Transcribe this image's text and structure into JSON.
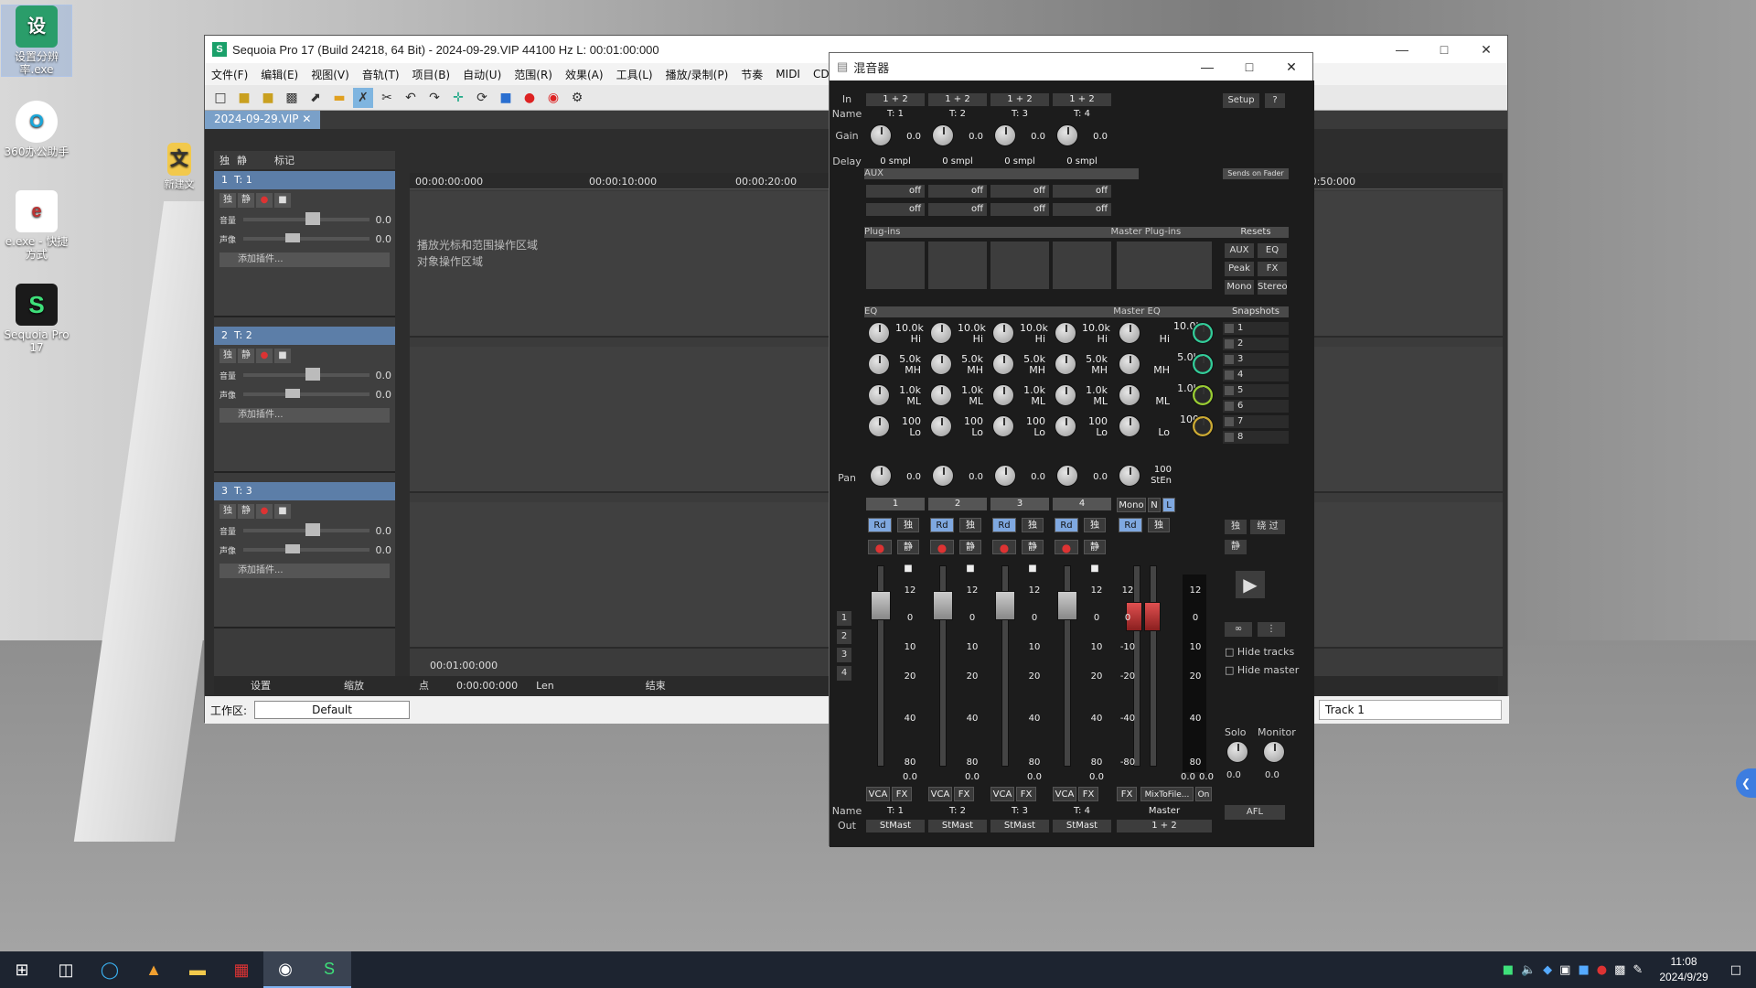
{
  "desktop": {
    "icons": [
      {
        "label": "设置分辨率.exe",
        "color": "#2a9d6a",
        "glyph": "设"
      },
      {
        "label": "360办公助手",
        "color": "#19a6d9",
        "glyph": "O"
      },
      {
        "label": "新建文",
        "color": "#f2c94c",
        "glyph": "文"
      },
      {
        "label": "e.exe - 快捷方式",
        "color": "#b33",
        "glyph": "e"
      },
      {
        "label": "Sequoia Pro 17",
        "color": "#1ca25f",
        "glyph": "S"
      }
    ]
  },
  "main_window": {
    "title": "Sequoia Pro 17 (Build 24218, 64 Bit) - 2024-09-29.VIP   44100 Hz L: 00:01:00:000",
    "menu": [
      "文件(F)",
      "编辑(E)",
      "视图(V)",
      "音轨(T)",
      "项目(B)",
      "自动(U)",
      "范围(R)",
      "效果(A)",
      "工具(L)",
      "播放/录制(P)",
      "节奏",
      "MIDI",
      "CD/D"
    ],
    "tab": "2024-09-29.VIP",
    "header_row": {
      "solo": "独",
      "mute": "静",
      "markers": "标记"
    },
    "tracks": [
      {
        "num": "1",
        "name": "T: 1"
      },
      {
        "num": "2",
        "name": "T: 2"
      },
      {
        "num": "3",
        "name": "T: 3"
      }
    ],
    "track_controls": {
      "solo": "独",
      "mute": "静",
      "volume": "音量",
      "pan": "声像",
      "plugin": "添加插件...",
      "vol_value": "0.0",
      "pan_value": "0.0"
    },
    "ruler": [
      "00:00:00:000",
      "00:00:10:000",
      "00:00:20:00",
      "00:00:50:000"
    ],
    "lane_hints": [
      "播放光标和范围操作区域",
      "对象操作区域"
    ],
    "bottom": {
      "settings": "设置",
      "zoom": "缩放",
      "position": "00:01:00:000",
      "point": "点",
      "point_time": "0:00:00:000",
      "len": "Len",
      "end": "结束"
    },
    "workspace_label": "工作区:",
    "workspace_value": "Default",
    "status_track": "Track 1"
  },
  "mixer": {
    "title": "混音器",
    "row_labels": {
      "in": "In",
      "name": "Name",
      "gain": "Gain",
      "delay": "Delay",
      "pan": "Pan",
      "out": "Out"
    },
    "section_titles": {
      "aux": "AUX",
      "plugins": "Plug-ins",
      "master_plugins": "Master Plug-ins",
      "eq": "EQ",
      "master_eq": "Master EQ",
      "resets": "Resets",
      "snapshots": "Snapshots",
      "sends_on_fader": "Sends on Fader"
    },
    "channels": [
      {
        "in": "1 + 2",
        "name": "T: 1",
        "gain": "0.0",
        "delay": "0 smpl",
        "aux1": "off",
        "aux2": "off",
        "pan": "0.0",
        "num": "1",
        "out": "StMast",
        "level": "0.0"
      },
      {
        "in": "1 + 2",
        "name": "T: 2",
        "gain": "0.0",
        "delay": "0 smpl",
        "aux1": "off",
        "aux2": "off",
        "pan": "0.0",
        "num": "2",
        "out": "StMast",
        "level": "0.0"
      },
      {
        "in": "1 + 2",
        "name": "T: 3",
        "gain": "0.0",
        "delay": "0 smpl",
        "aux1": "off",
        "aux2": "off",
        "pan": "0.0",
        "num": "3",
        "out": "StMast",
        "level": "0.0"
      },
      {
        "in": "1 + 2",
        "name": "T: 4",
        "gain": "0.0",
        "delay": "0 smpl",
        "aux1": "off",
        "aux2": "off",
        "pan": "0.0",
        "num": "4",
        "out": "StMast",
        "level": "0.0"
      }
    ],
    "eq_bands": [
      {
        "freq": "10.0k",
        "label": "Hi"
      },
      {
        "freq": "5.0k",
        "label": "MH"
      },
      {
        "freq": "1.0k",
        "label": "ML"
      },
      {
        "freq": "100",
        "label": "Lo"
      }
    ],
    "buttons": {
      "rd": "Rd",
      "solo": "独",
      "mute": "静",
      "vca": "VCA",
      "fx": "FX",
      "setup": "Setup",
      "help": "?",
      "bypass": "绕 过",
      "mono": "Mono",
      "n": "N",
      "l": "L"
    },
    "fader_scale": [
      "12",
      "0",
      "10",
      "20",
      "40",
      "80"
    ],
    "master_scale": [
      "12",
      "0",
      "-10",
      "-20",
      "-40",
      "-80"
    ],
    "master": {
      "name": "Master",
      "out": "1 + 2",
      "pan": "100",
      "pan_label": "StEn",
      "level_l": "0.0",
      "level_r": "0.0",
      "mixtofile": "MixToFile...",
      "on": "On"
    },
    "resets": [
      "AUX",
      "EQ",
      "Peak",
      "FX",
      "Mono",
      "Stereo"
    ],
    "snapshots": [
      "1",
      "2",
      "3",
      "4",
      "5",
      "6",
      "7",
      "8"
    ],
    "hide_tracks": "Hide tracks",
    "hide_master": "Hide master",
    "solo_label": "Solo",
    "monitor_label": "Monitor",
    "solo_value": "0.0",
    "monitor_value": "0.0",
    "afl": "AFL",
    "group_nums": [
      "1",
      "2",
      "3",
      "4"
    ]
  },
  "taskbar": {
    "time": "11:08",
    "date": "2024/9/29"
  }
}
